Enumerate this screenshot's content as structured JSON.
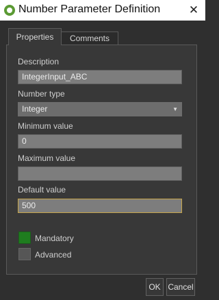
{
  "window": {
    "title": "Number Parameter Definition",
    "close_glyph": "✕"
  },
  "tabs": [
    {
      "label": "Properties"
    },
    {
      "label": "Comments"
    }
  ],
  "form": {
    "description": {
      "label": "Description",
      "value": "IntegerInput_ABC"
    },
    "number_type": {
      "label": "Number type",
      "value": "Integer"
    },
    "minimum": {
      "label": "Minimum value",
      "value": "0"
    },
    "maximum": {
      "label": "Maximum value",
      "value": ""
    },
    "default": {
      "label": "Default value",
      "value": "500"
    },
    "mandatory": {
      "label": "Mandatory",
      "checked": true,
      "color": "#1f7d1f"
    },
    "advanced": {
      "label": "Advanced",
      "checked": false,
      "color": "#565656"
    }
  },
  "buttons": {
    "ok": "OK",
    "cancel": "Cancel"
  },
  "icons": {
    "app": "qgis-logo-icon",
    "close": "close-icon",
    "dropdown": "chevron-down-icon"
  }
}
